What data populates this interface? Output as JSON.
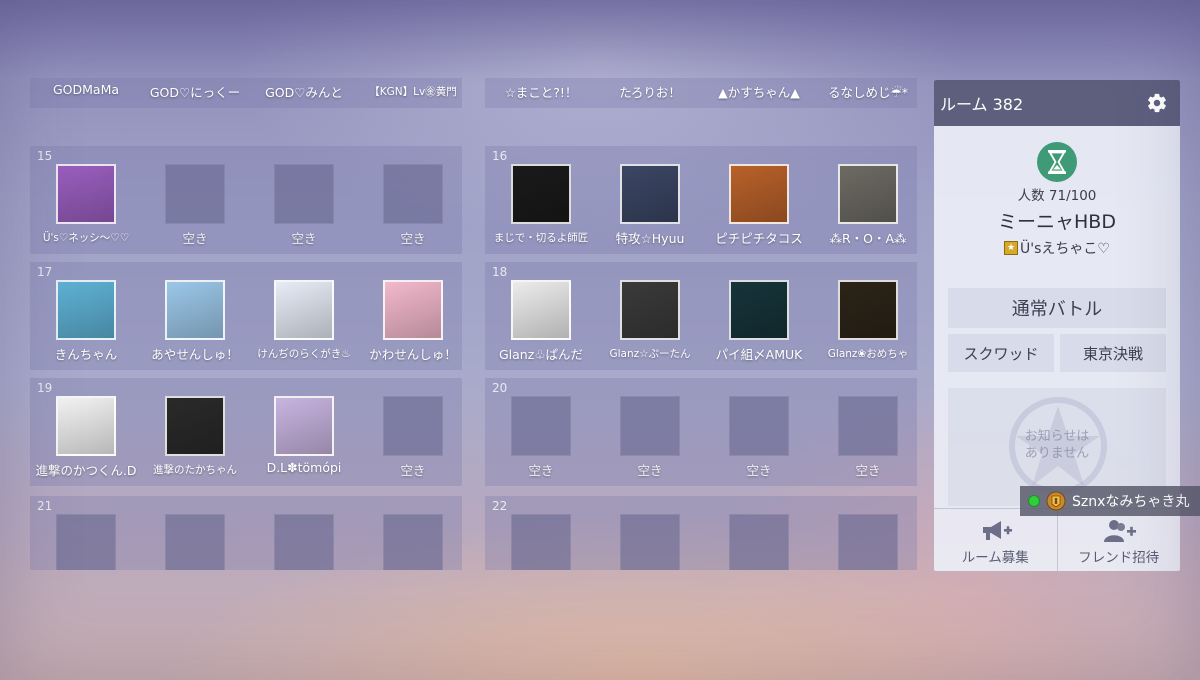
{
  "teams": [
    {
      "number": "",
      "slots": [
        {
          "name": "GODMaMa",
          "filled": true,
          "avatar_color": "#7a2f3a",
          "avatar_glyph": ""
        },
        {
          "name": "GOD♡にっくー",
          "filled": true,
          "avatar_color": "#3a2c1c",
          "avatar_glyph": ""
        },
        {
          "name": "GOD♡みんと",
          "filled": true,
          "avatar_color": "#3a2c1c",
          "avatar_glyph": ""
        },
        {
          "name": "【KGN】Lv㊎黄門",
          "filled": true,
          "avatar_color": "#1b2c6a",
          "avatar_glyph": "",
          "small": true
        }
      ]
    },
    {
      "number": "",
      "slots": [
        {
          "name": "☆まこと?!！",
          "filled": true,
          "avatar_color": "#d7b98a",
          "avatar_glyph": ""
        },
        {
          "name": "たろりお！",
          "filled": true,
          "avatar_color": "#2a2a2a",
          "avatar_glyph": ""
        },
        {
          "name": "▲かすちゃん▲",
          "filled": true,
          "avatar_color": "#d88fc4",
          "avatar_glyph": ""
        },
        {
          "name": "るなしめじ☔*",
          "filled": true,
          "avatar_color": "#8a8373",
          "avatar_glyph": ""
        }
      ]
    },
    {
      "number": "15",
      "slots": [
        {
          "name": "Ü's♡ネッシ〜♡♡",
          "filled": true,
          "avatar_color": "#9b5fc0",
          "avatar_glyph": "",
          "small": true
        },
        {
          "name": "空き",
          "filled": false
        },
        {
          "name": "空き",
          "filled": false
        },
        {
          "name": "空き",
          "filled": false
        }
      ]
    },
    {
      "number": "16",
      "slots": [
        {
          "name": "まじで・切るよ師匠",
          "filled": true,
          "avatar_color": "#1a1a1a",
          "avatar_glyph": "",
          "small": true
        },
        {
          "name": "特攻☆Hyuu",
          "filled": true,
          "avatar_color": "#3b4664",
          "avatar_glyph": ""
        },
        {
          "name": "ピチピチタコス",
          "filled": true,
          "avatar_color": "#b8612a",
          "avatar_glyph": ""
        },
        {
          "name": "⁂R・O・A⁂",
          "filled": true,
          "avatar_color": "#6d6a63",
          "avatar_glyph": ""
        }
      ]
    },
    {
      "number": "17",
      "slots": [
        {
          "name": "きんちゃん",
          "filled": true,
          "avatar_color": "#5fb3d6",
          "avatar_glyph": ""
        },
        {
          "name": "あやせんしゅ！",
          "filled": true,
          "avatar_color": "#9bc7e8",
          "avatar_glyph": ""
        },
        {
          "name": "けんぢのらくがき♨",
          "filled": true,
          "avatar_color": "#e6ecf6",
          "avatar_glyph": "",
          "small": true
        },
        {
          "name": "かわせんしゅ！",
          "filled": true,
          "avatar_color": "#f2b8cc",
          "avatar_glyph": ""
        }
      ]
    },
    {
      "number": "18",
      "slots": [
        {
          "name": "Glanz♧ぱんだ",
          "filled": true,
          "avatar_color": "#ececec",
          "avatar_glyph": ""
        },
        {
          "name": "Glanz☆ぷーたん",
          "filled": true,
          "avatar_color": "#3a3a3a",
          "avatar_glyph": "",
          "small": true
        },
        {
          "name": "パイ組〆AMUK",
          "filled": true,
          "avatar_color": "#16343a",
          "avatar_glyph": ""
        },
        {
          "name": "Glanz❀おめちゃ",
          "filled": true,
          "avatar_color": "#2c2418",
          "avatar_glyph": "",
          "small": true
        }
      ]
    },
    {
      "number": "19",
      "slots": [
        {
          "name": "進撃のかつくん.D",
          "filled": true,
          "avatar_color": "#f4f4f4",
          "avatar_glyph": ""
        },
        {
          "name": "進撃のたかちゃん",
          "filled": true,
          "avatar_color": "#2a2a2a",
          "avatar_glyph": "",
          "small": true
        },
        {
          "name": "D.L✽tömópi",
          "filled": true,
          "avatar_color": "#c8b4e0",
          "avatar_glyph": ""
        },
        {
          "name": "空き",
          "filled": false
        }
      ]
    },
    {
      "number": "20",
      "slots": [
        {
          "name": "空き",
          "filled": false
        },
        {
          "name": "空き",
          "filled": false
        },
        {
          "name": "空き",
          "filled": false
        },
        {
          "name": "空き",
          "filled": false
        }
      ]
    },
    {
      "number": "21",
      "slots": [
        {
          "name": "",
          "filled": false
        },
        {
          "name": "",
          "filled": false
        },
        {
          "name": "",
          "filled": false
        },
        {
          "name": "",
          "filled": false
        }
      ]
    },
    {
      "number": "22",
      "slots": [
        {
          "name": "",
          "filled": false
        },
        {
          "name": "",
          "filled": false
        },
        {
          "name": "",
          "filled": false
        },
        {
          "name": "",
          "filled": false
        }
      ]
    }
  ],
  "room": {
    "title": "ルーム 382",
    "count": "人数 71/100",
    "name": "ミーニャHBD",
    "owner": "Ü'sえちゃこ♡",
    "owner_badge": "★",
    "main_button": "通常バトル",
    "squad_button": "スクワッド",
    "tokyo_button": "東京決戦",
    "notice_line1": "お知らせは",
    "notice_line2": "ありません",
    "recruit_button": "ルーム募集",
    "invite_button": "フレンド招待",
    "accent_color": "#3e9a77",
    "header_color": "#5d5f7d"
  },
  "online_toast": {
    "name": "Sznxなみちゃき丸",
    "status_color": "#2fcf3c"
  }
}
